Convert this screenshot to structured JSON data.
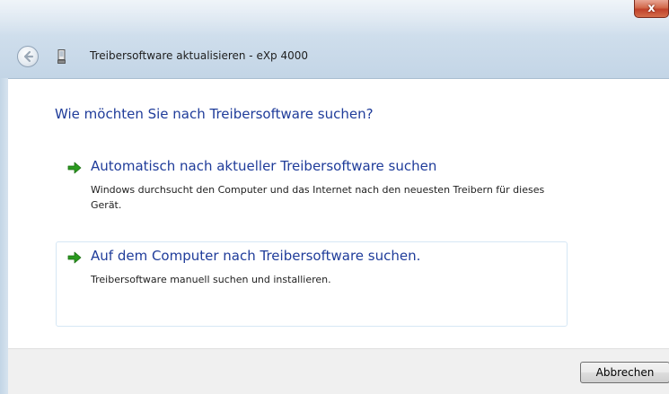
{
  "window": {
    "title": "Treibersoftware aktualisieren - eXp 4000",
    "close_label": "x"
  },
  "icons": {
    "back": "back-arrow-icon",
    "device": "device-icon",
    "option_arrow": "green-arrow-icon"
  },
  "main": {
    "heading": "Wie möchten Sie nach Treibersoftware suchen?",
    "options": [
      {
        "title": "Automatisch nach aktueller Treibersoftware suchen",
        "description": "Windows durchsucht den Computer und das Internet nach den neuesten Treibern für dieses Gerät."
      },
      {
        "title": "Auf dem Computer nach Treibersoftware suchen.",
        "description": "Treibersoftware manuell suchen und installieren."
      }
    ]
  },
  "footer": {
    "cancel_label": "Abbrechen"
  },
  "colors": {
    "link_blue": "#1f3c9a",
    "arrow_green": "#2a9a1e",
    "close_red": "#c0412a"
  }
}
